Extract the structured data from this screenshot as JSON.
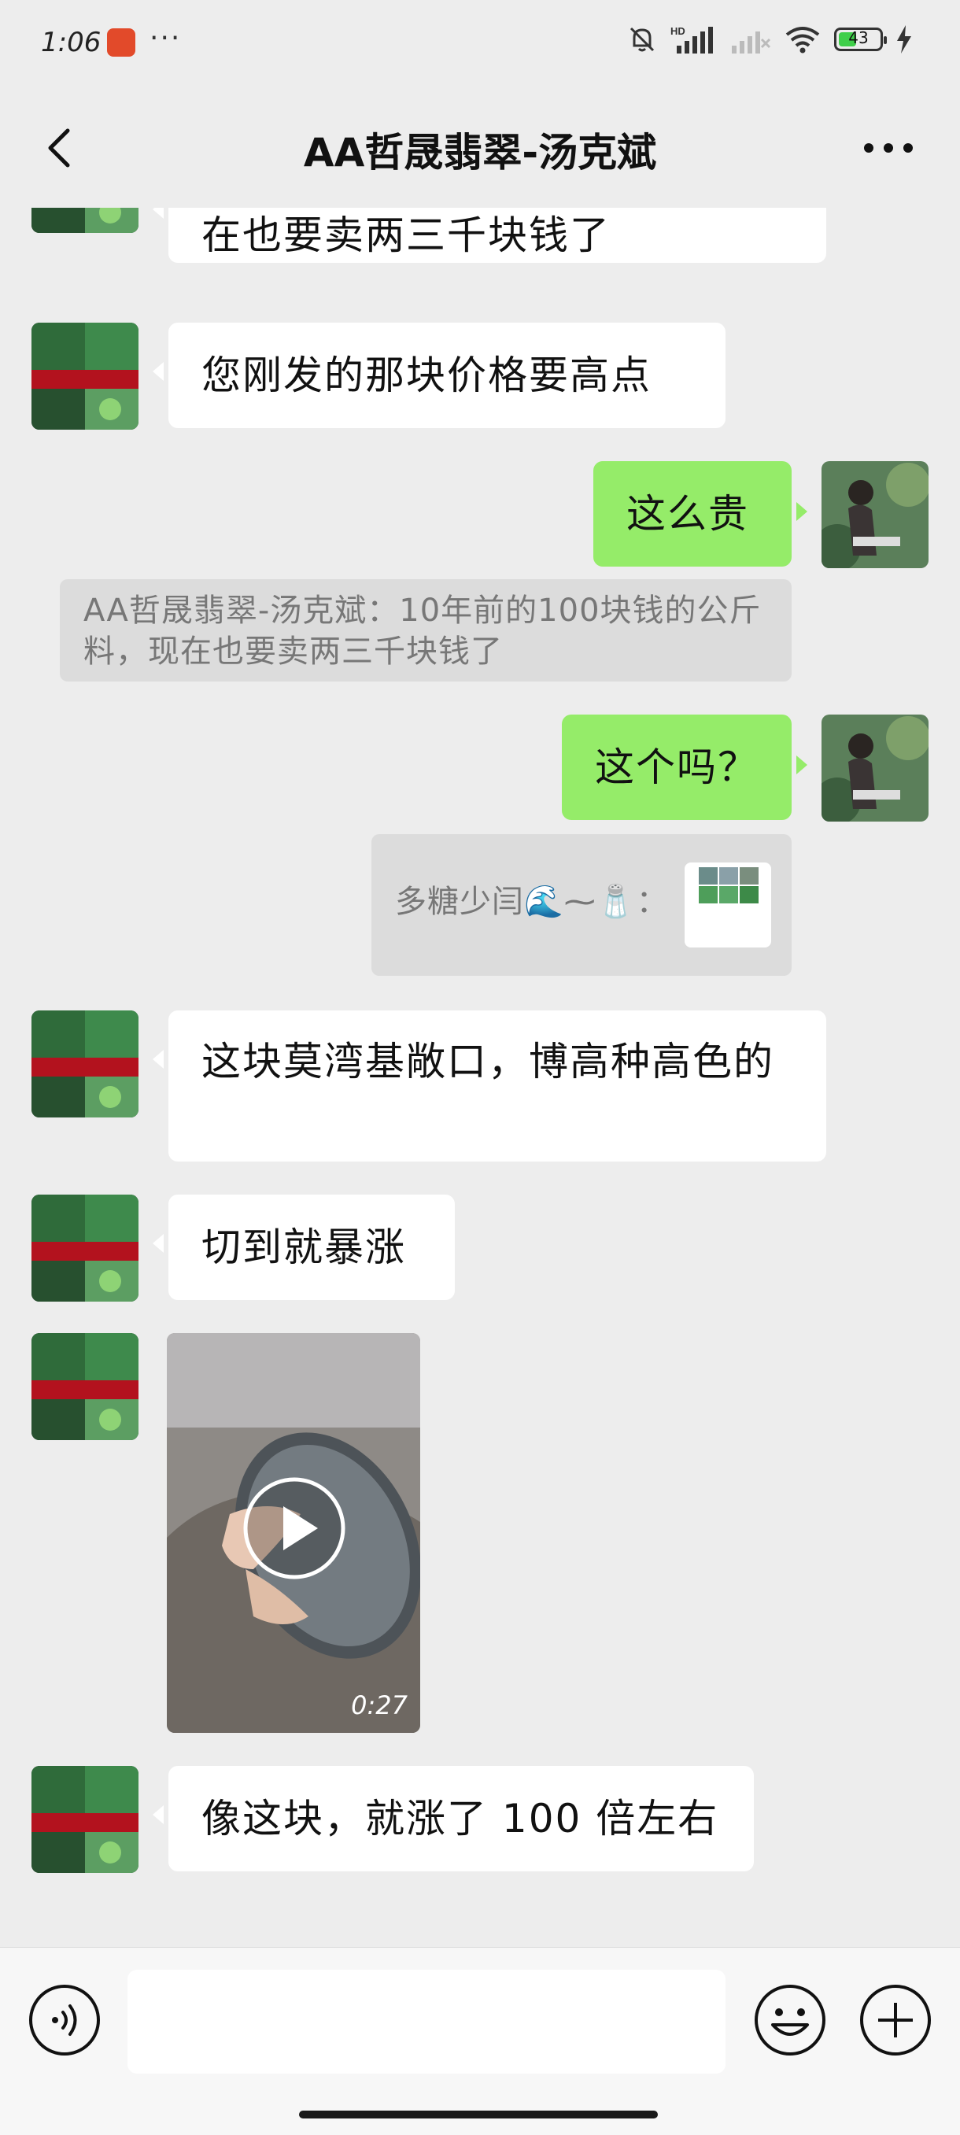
{
  "status_bar": {
    "time": "1:06",
    "dots": "···",
    "battery": "43",
    "network_label": "HD"
  },
  "header": {
    "title": "AA哲晟翡翠-汤克斌"
  },
  "messages": {
    "m0_text": "在也要卖两三千块钱了",
    "m1_text": "您刚发的那块价格要高点",
    "m2_text": "这么贵",
    "m3_quote": "AA哲晟翡翠-汤克斌：10年前的100块钱的公斤料，现在也要卖两三千块钱了",
    "m4_text": "这个吗？",
    "m5_quote_name": "多糖少闫🌊⁓🧂：",
    "m6_text": "这块莫湾基敞口，博高种高色的",
    "m7_text": "切到就暴涨",
    "m8_video_duration": "0:27",
    "m9_text": "像这块，就涨了 100 倍左右"
  },
  "icons": {
    "back": "chevron-left-icon",
    "more": "more-dots-icon",
    "voice": "voice-icon",
    "emoji": "emoji-icon",
    "plus": "plus-icon",
    "play": "play-icon"
  },
  "colors": {
    "chat_bg": "#ededed",
    "bubble_in": "#ffffff",
    "bubble_out": "#95ec69",
    "quote_bg": "#dcdcdc"
  }
}
